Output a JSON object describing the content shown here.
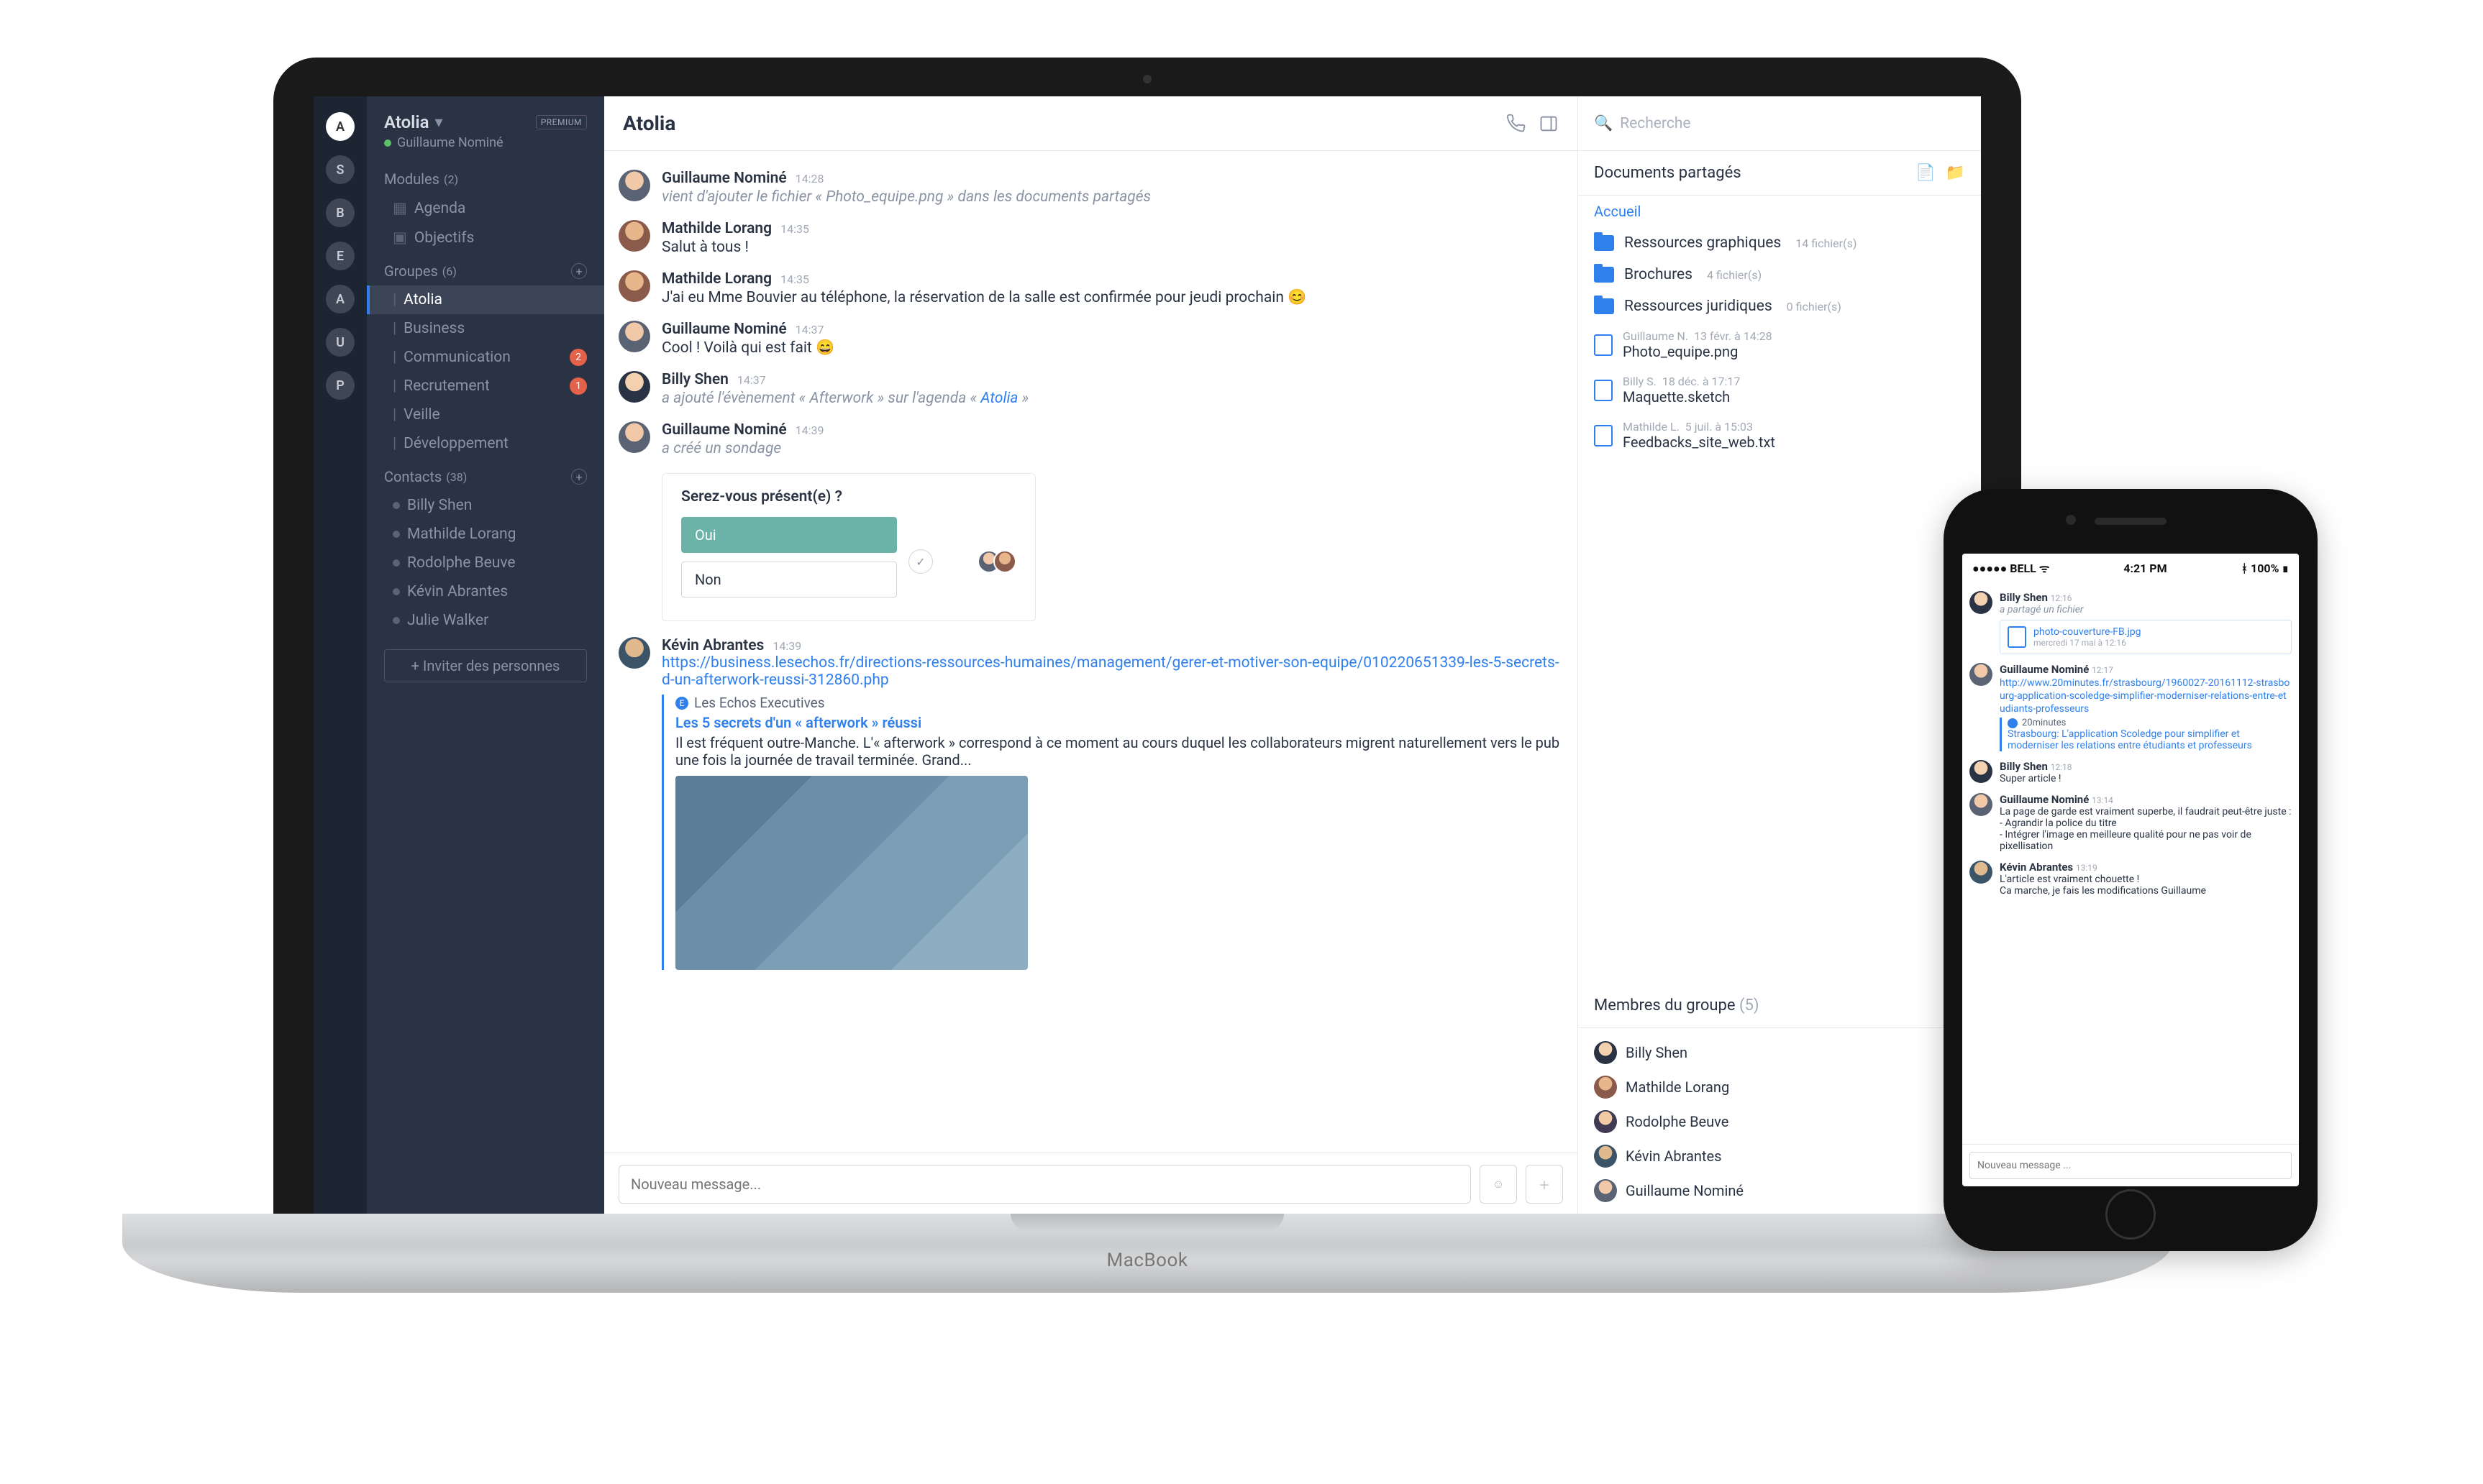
{
  "macbook_label": "MacBook",
  "workspace": {
    "name": "Atolia",
    "badge": "PREMIUM",
    "user": "Guillaume Nominé"
  },
  "modules": {
    "label": "Modules",
    "count": "(2)",
    "items": [
      {
        "icon": "calendar-icon",
        "label": "Agenda"
      },
      {
        "icon": "grid-icon",
        "label": "Objectifs"
      }
    ]
  },
  "groups": {
    "label": "Groupes",
    "count": "(6)",
    "items": [
      {
        "label": "Atolia",
        "active": true
      },
      {
        "label": "Business"
      },
      {
        "label": "Communication",
        "badge": "2"
      },
      {
        "label": "Recrutement",
        "badge": "1"
      },
      {
        "label": "Veille"
      },
      {
        "label": "Développement"
      }
    ]
  },
  "contacts": {
    "label": "Contacts",
    "count": "(38)",
    "items": [
      {
        "label": "Billy Shen"
      },
      {
        "label": "Mathilde Lorang"
      },
      {
        "label": "Rodolphe Beuve"
      },
      {
        "label": "Kévin Abrantes"
      },
      {
        "label": "Julie Walker"
      }
    ]
  },
  "invite_label": "+ Inviter des personnes",
  "rail": [
    "A",
    "S",
    "B",
    "E",
    "A",
    "U",
    "P"
  ],
  "channel_title": "Atolia",
  "search_placeholder": "Recherche",
  "messages": [
    {
      "avatar": "a",
      "name": "Guillaume Nominé",
      "time": "14:28",
      "sys": true,
      "text": "vient d'ajouter le fichier « Photo_equipe.png » dans les documents partagés"
    },
    {
      "avatar": "b",
      "name": "Mathilde Lorang",
      "time": "14:35",
      "text": "Salut à tous !"
    },
    {
      "avatar": "b",
      "name": "Mathilde Lorang",
      "time": "14:35",
      "text": "J'ai eu Mme Bouvier au téléphone, la réservation de la salle est confirmée pour jeudi prochain 😊"
    },
    {
      "avatar": "a",
      "name": "Guillaume Nominé",
      "time": "14:37",
      "text": "Cool ! Voilà qui est fait 😄"
    },
    {
      "avatar": "c",
      "name": "Billy Shen",
      "time": "14:37",
      "sys": true,
      "html": true,
      "text": "a ajouté l'évènement « Afterwork » sur l'agenda « ",
      "link": "Atolia",
      "suffix": " »"
    },
    {
      "avatar": "a",
      "name": "Guillaume Nominé",
      "time": "14:39",
      "sys": true,
      "text": "a créé un sondage"
    }
  ],
  "poll": {
    "question": "Serez-vous présent(e) ?",
    "options": [
      "Oui",
      "Non"
    ]
  },
  "link_msg": {
    "avatar": "d",
    "name": "Kévin Abrantes",
    "time": "14:39",
    "url": "https://business.lesechos.fr/directions-ressources-humaines/management/gerer-et-motiver-son-equipe/010220651339-les-5-secrets-d-un-afterwork-reussi-312860.php",
    "source": "Les Echos Executives",
    "title": "Les 5 secrets d'un « afterwork » réussi",
    "desc": "Il est fréquent outre-Manche. L'« afterwork » correspond à ce moment au cours duquel les collaborateurs migrent naturellement vers le pub une fois la journée de travail terminée. Grand..."
  },
  "composer_placeholder": "Nouveau message...",
  "docs": {
    "title": "Documents partagés",
    "home": "Accueil",
    "folders": [
      {
        "name": "Ressources graphiques",
        "meta": "14 fichier(s)"
      },
      {
        "name": "Brochures",
        "meta": "4 fichier(s)"
      },
      {
        "name": "Ressources juridiques",
        "meta": "0 fichier(s)"
      }
    ],
    "files": [
      {
        "owner": "Guillaume N.",
        "date": "13 févr. à 14:28",
        "name": "Photo_equipe.png"
      },
      {
        "owner": "Billy S.",
        "date": "18 déc. à 17:17",
        "name": "Maquette.sketch"
      },
      {
        "owner": "Mathilde L.",
        "date": "5 juil. à 15:03",
        "name": "Feedbacks_site_web.txt"
      }
    ]
  },
  "members": {
    "title": "Membres du groupe",
    "count": "(5)",
    "items": [
      {
        "avatar": "c",
        "name": "Billy Shen"
      },
      {
        "avatar": "b",
        "name": "Mathilde Lorang"
      },
      {
        "avatar": "e",
        "name": "Rodolphe Beuve"
      },
      {
        "avatar": "d",
        "name": "Kévin Abrantes"
      },
      {
        "avatar": "a",
        "name": "Guillaume Nominé"
      }
    ]
  },
  "phone": {
    "status": {
      "carrier": "●●●●● BELL",
      "wifi": "ᯤ",
      "time": "4:21 PM",
      "bt": "ᚼ",
      "batt": "100% ▮"
    },
    "messages": [
      {
        "avatar": "c",
        "name": "Billy Shen",
        "time": "12:16",
        "sys": true,
        "text": "a partagé un fichier",
        "attachment": {
          "name": "photo-couverture-FB.jpg",
          "date": "mercredi 17 mai à 12:16"
        }
      },
      {
        "avatar": "a",
        "name": "Guillaume Nominé",
        "time": "12:17",
        "link": "http://www.20minutes.fr/strasbourg/1960027-20161112-strasbourg-application-scoledge-simplifier-moderniser-relations-entre-etudiants-professeurs",
        "preview": {
          "source": "20minutes",
          "title": "Strasbourg: L'application Scoledge pour simplifier et moderniser les relations entre étudiants et professeurs"
        }
      },
      {
        "avatar": "c",
        "name": "Billy Shen",
        "time": "12:18",
        "text": "Super article !"
      },
      {
        "avatar": "a",
        "name": "Guillaume Nominé",
        "time": "13:14",
        "lines": [
          "La page de garde est vraiment superbe, il faudrait peut-être juste :",
          "- Agrandir la police du titre",
          "- Intégrer l'image en meilleure qualité pour ne pas voir de pixellisation"
        ]
      },
      {
        "avatar": "d",
        "name": "Kévin Abrantes",
        "time": "13:19",
        "lines": [
          "L'article est vraiment chouette !",
          "Ca marche, je fais les modifications Guillaume"
        ]
      }
    ],
    "composer_placeholder": "Nouveau message ..."
  }
}
